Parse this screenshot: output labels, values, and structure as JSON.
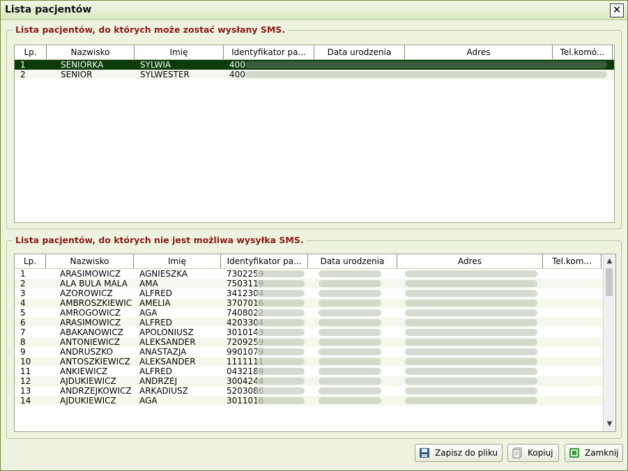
{
  "window": {
    "title": "Lista pacjentów"
  },
  "top_group": {
    "legend": "Lista pacjentów, do których może zostać wysłany SMS.",
    "columns": [
      "Lp.",
      "Nazwisko",
      "Imię",
      "Identyfikator pa...",
      "Data urodzenia",
      "Adres",
      "Tel.komó..."
    ],
    "rows": [
      {
        "lp": "1",
        "nazwisko": "SENIORKA",
        "imie": "SYLWIA",
        "id": "400",
        "selected": true
      },
      {
        "lp": "2",
        "nazwisko": "SENIOR",
        "imie": "SYLWESTER",
        "id": "400",
        "selected": false
      }
    ]
  },
  "bottom_group": {
    "legend": "Lista pacjentów, do których nie jest możliwa wysyłka SMS.",
    "columns": [
      "Lp.",
      "Nazwisko",
      "Imię",
      "Identyfikator pa...",
      "Data urodzenia",
      "Adres",
      "Tel.kom..."
    ],
    "rows": [
      {
        "lp": "1",
        "nazwisko": "ARASIMOWICZ",
        "imie": "AGNIESZKA",
        "id": "7302259"
      },
      {
        "lp": "2",
        "nazwisko": "ALA BULA MALA",
        "imie": "AMA",
        "id": "7503119"
      },
      {
        "lp": "3",
        "nazwisko": "AZOROWICZ",
        "imie": "ALFRED",
        "id": "3412304"
      },
      {
        "lp": "4",
        "nazwisko": "AMBROSZKIEWIC",
        "imie": "AMELIA",
        "id": "3707016"
      },
      {
        "lp": "5",
        "nazwisko": "AMROGOWICZ",
        "imie": "AGA",
        "id": "7408022"
      },
      {
        "lp": "6",
        "nazwisko": "ARASIMOWICZ",
        "imie": "ALFRED",
        "id": "4203304"
      },
      {
        "lp": "7",
        "nazwisko": "ABAKANOWICZ",
        "imie": "APOLONIUSZ",
        "id": "3010143"
      },
      {
        "lp": "8",
        "nazwisko": "ANTONIEWICZ",
        "imie": "ALEKSANDER",
        "id": "7209259"
      },
      {
        "lp": "9",
        "nazwisko": "ANDRUSZKO",
        "imie": "ANASTAZJA",
        "id": "9901079"
      },
      {
        "lp": "10",
        "nazwisko": "ANTOSZKIEWICZ",
        "imie": "ALEKSANDER",
        "id": "1111111"
      },
      {
        "lp": "11",
        "nazwisko": "ANKIEWICZ",
        "imie": "ALFRED",
        "id": "0432189"
      },
      {
        "lp": "12",
        "nazwisko": "AJDUKIEWICZ",
        "imie": "ANDRZEJ",
        "id": "3004244"
      },
      {
        "lp": "13",
        "nazwisko": "ANDRZEJKOWICZ",
        "imie": "ARKADIUSZ",
        "id": "5203086"
      },
      {
        "lp": "14",
        "nazwisko": "AJDUKIEWICZ",
        "imie": "AGA",
        "id": "3011018"
      }
    ]
  },
  "buttons": {
    "save": "Zapisz do pliku",
    "copy": "Kopiuj",
    "close": "Zamknij"
  },
  "icons": {
    "close": "close-x-icon",
    "save": "floppy-disk-icon",
    "copy": "copy-document-icon",
    "exit": "exit-icon",
    "scroll_up": "chevron-up-icon",
    "scroll_down": "chevron-down-icon"
  }
}
